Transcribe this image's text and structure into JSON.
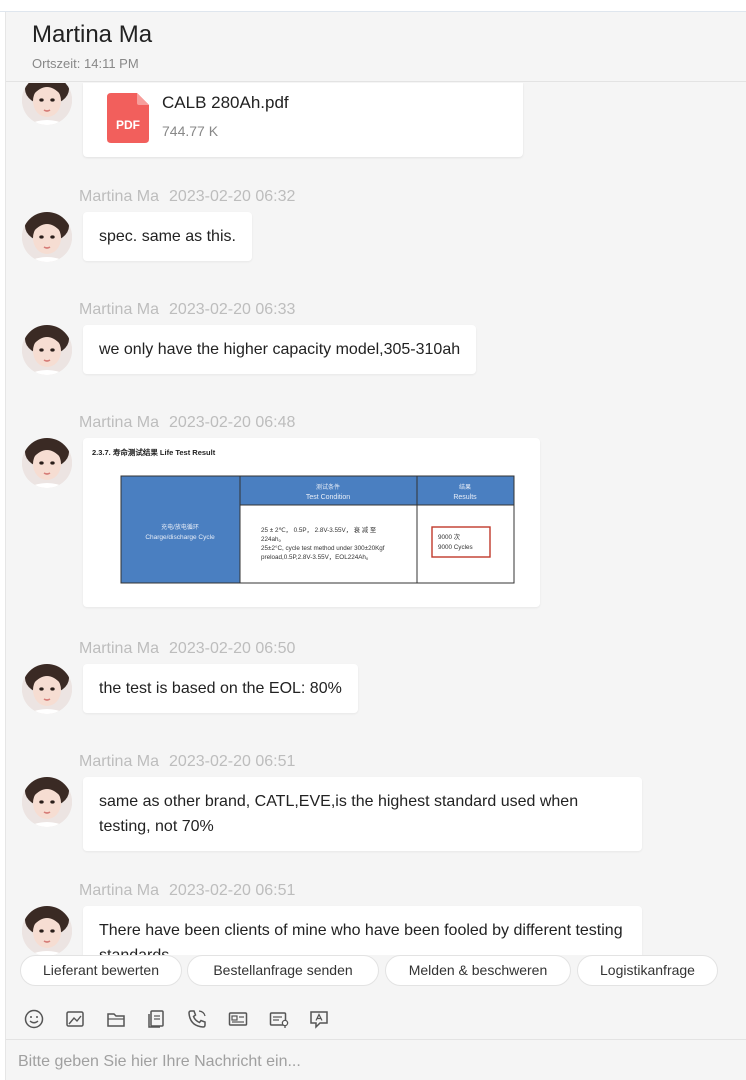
{
  "header": {
    "contact_name": "Martina Ma",
    "local_time": "Ortszeit: 14:11 PM"
  },
  "messages": [
    {
      "type": "file",
      "file_name": "CALB 280Ah.pdf",
      "file_size": "744.77 K",
      "icon": "pdf-icon",
      "icon_label": "PDF"
    },
    {
      "type": "text",
      "sender": "Martina Ma",
      "time": "2023-02-20 06:32",
      "text": "spec. same as this."
    },
    {
      "type": "text",
      "sender": "Martina Ma",
      "time": "2023-02-20 06:33",
      "text": "we only have the higher capacity model,305-310ah"
    },
    {
      "type": "image",
      "sender": "Martina Ma",
      "time": "2023-02-20 06:48",
      "image": {
        "heading": "2.3.7. 寿命测试结果 Life Test Result",
        "col1_header": "",
        "col2_header_cn": "测试条件",
        "col2_header_en": "Test Condition",
        "col3_header_cn": "结果",
        "col3_header_en": "Results",
        "row_label_cn": "充电/放电循环",
        "row_label_en": "Charge/discharge Cycle",
        "condition_line1": "25 ± 2℃， 0.5P， 2.8V-3.55V， 衰 减 至",
        "condition_line2": "224ah。",
        "condition_line3": "25±2°C, cycle test method under 300±20Kgf",
        "condition_line4": "preload,0.5P,2.8V-3.55V，EOL224Ah。",
        "result_line1": "9000 次",
        "result_line2": "9000 Cycles"
      }
    },
    {
      "type": "text",
      "sender": "Martina Ma",
      "time": "2023-02-20 06:50",
      "text": "the test is based on the EOL: 80%"
    },
    {
      "type": "text",
      "sender": "Martina Ma",
      "time": "2023-02-20 06:51",
      "text": "same as other brand, CATL,EVE,is the highest standard used when testing, not 70%"
    },
    {
      "type": "text",
      "sender": "Martina Ma",
      "time": "2023-02-20 06:51",
      "text": "There have been clients of mine who have been fooled by different testing standards"
    }
  ],
  "quick_actions": [
    "Lieferant bewerten",
    "Bestellanfrage senden",
    "Melden & beschweren",
    "Logistikanfrage"
  ],
  "toolbar_icons": [
    "emoji-icon",
    "image-icon",
    "folder-icon",
    "document-icon",
    "phone-icon",
    "business-card-icon",
    "address-icon",
    "translate-icon"
  ],
  "composer": {
    "placeholder": "Bitte geben Sie hier Ihre Nachricht ein..."
  },
  "colors": {
    "pdf_red": "#f25f5c",
    "table_blue": "#4a7fc1",
    "result_box": "#c0392b"
  }
}
